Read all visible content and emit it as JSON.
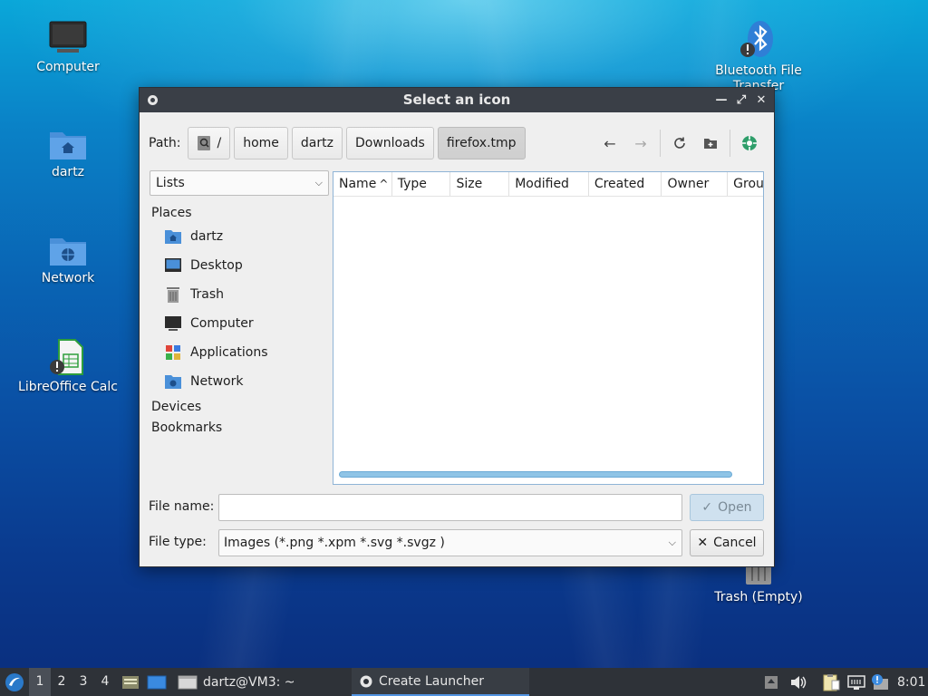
{
  "desktop": {
    "icons": [
      {
        "label": "Computer"
      },
      {
        "label": "dartz"
      },
      {
        "label": "Network"
      },
      {
        "label": "LibreOffice Calc"
      },
      {
        "label": "Bluetooth File Transfer"
      },
      {
        "label": "Trash (Empty)"
      }
    ]
  },
  "dialog": {
    "title": "Select an icon",
    "path_label": "Path:",
    "crumbs": [
      "/",
      "home",
      "dartz",
      "Downloads",
      "firefox.tmp"
    ],
    "sidebar_view": "Lists",
    "places_header": "Places",
    "places": [
      "dartz",
      "Desktop",
      "Trash",
      "Computer",
      "Applications",
      "Network"
    ],
    "devices_header": "Devices",
    "bookmarks_header": "Bookmarks",
    "columns": [
      "Name",
      "Type",
      "Size",
      "Modified",
      "Created",
      "Owner",
      "Grou"
    ],
    "sort_indicator": "^",
    "filename_label": "File name:",
    "filename_value": "",
    "open_label": "Open",
    "filetype_label": "File type:",
    "filetype_value": "Images (*.png *.xpm *.svg *.svgz )",
    "cancel_label": "Cancel"
  },
  "taskbar": {
    "workspaces": [
      "1",
      "2",
      "3",
      "4"
    ],
    "tasks": [
      {
        "label": "dartz@VM3: ~"
      },
      {
        "label": "Create Launcher"
      }
    ],
    "clock": "8:01"
  },
  "colors": {
    "accent": "#5294e2",
    "titlebar": "#3a3f47",
    "taskbar": "#2e3238"
  }
}
